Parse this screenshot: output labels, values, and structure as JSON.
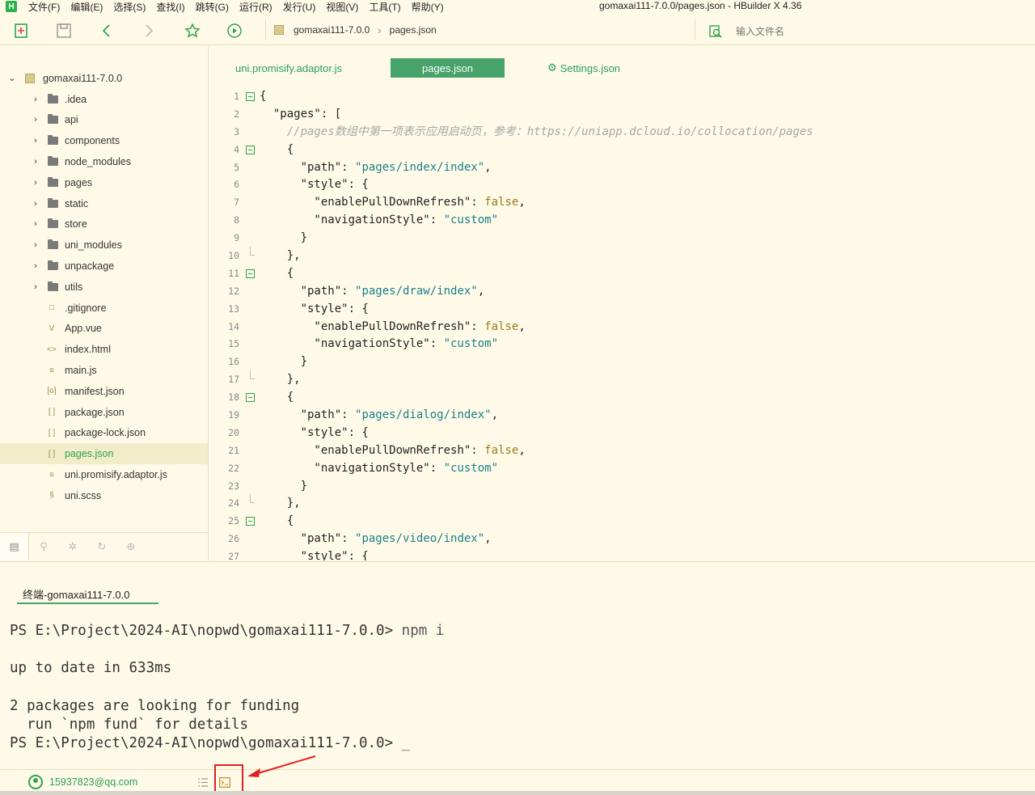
{
  "app": {
    "logo_letter": "H",
    "window_title": "gomaxai111-7.0.0/pages.json - HBuilder X 4.36",
    "menu": [
      "文件(F)",
      "编辑(E)",
      "选择(S)",
      "查找(I)",
      "跳转(G)",
      "运行(R)",
      "发行(U)",
      "视图(V)",
      "工具(T)",
      "帮助(Y)"
    ]
  },
  "toolbar": {
    "breadcrumb": [
      "gomaxai111-7.0.0",
      "pages.json"
    ],
    "file_search_placeholder": "输入文件名"
  },
  "sidebar": {
    "project": "gomaxai111-7.0.0",
    "folders": [
      ".idea",
      "api",
      "components",
      "node_modules",
      "pages",
      "static",
      "store",
      "uni_modules",
      "unpackage",
      "utils"
    ],
    "files": [
      {
        "name": ".gitignore",
        "icon": "□"
      },
      {
        "name": "App.vue",
        "icon": "V"
      },
      {
        "name": "index.html",
        "icon": "<>"
      },
      {
        "name": "main.js",
        "icon": "≡"
      },
      {
        "name": "manifest.json",
        "icon": "[o]"
      },
      {
        "name": "package.json",
        "icon": "[ ]"
      },
      {
        "name": "package-lock.json",
        "icon": "[ ]"
      },
      {
        "name": "pages.json",
        "icon": "[ ]"
      },
      {
        "name": "uni.promisify.adaptor.js",
        "icon": "≡"
      },
      {
        "name": "uni.scss",
        "icon": "§"
      }
    ],
    "selected": "pages.json"
  },
  "editor": {
    "tabs": [
      "uni.promisify.adaptor.js",
      "pages.json",
      "Settings.json"
    ],
    "active_tab": "pages.json",
    "lines": [
      {
        "n": "1",
        "fold": "open",
        "t": [
          [
            "k",
            "{"
          ]
        ]
      },
      {
        "n": "2",
        "t": [
          [
            "k",
            "  "
          ],
          [
            "k",
            "\"pages\""
          ],
          [
            "k",
            ": ["
          ]
        ]
      },
      {
        "n": "3",
        "t": [
          [
            "k",
            "    "
          ],
          [
            "c",
            "//pages数组中第一项表示应用启动页，参考：https://uniapp.dcloud.io/collocation/pages"
          ]
        ]
      },
      {
        "n": "4",
        "fold": "open",
        "t": [
          [
            "k",
            "    {"
          ]
        ]
      },
      {
        "n": "5",
        "t": [
          [
            "k",
            "      \"path\": "
          ],
          [
            "s",
            "\"pages/index/index\""
          ],
          [
            "k",
            ","
          ]
        ]
      },
      {
        "n": "6",
        "t": [
          [
            "k",
            "      \"style\": {"
          ]
        ]
      },
      {
        "n": "7",
        "t": [
          [
            "k",
            "        \"enablePullDownRefresh\": "
          ],
          [
            "b",
            "false"
          ],
          [
            "k",
            ","
          ]
        ]
      },
      {
        "n": "8",
        "t": [
          [
            "k",
            "        \"navigationStyle\": "
          ],
          [
            "s",
            "\"custom\""
          ]
        ]
      },
      {
        "n": "9",
        "t": [
          [
            "k",
            "      }"
          ]
        ]
      },
      {
        "n": "10",
        "fold": "end",
        "t": [
          [
            "k",
            "    },"
          ]
        ]
      },
      {
        "n": "11",
        "fold": "open",
        "t": [
          [
            "k",
            "    {"
          ]
        ]
      },
      {
        "n": "12",
        "t": [
          [
            "k",
            "      \"path\": "
          ],
          [
            "s",
            "\"pages/draw/index\""
          ],
          [
            "k",
            ","
          ]
        ]
      },
      {
        "n": "13",
        "t": [
          [
            "k",
            "      \"style\": {"
          ]
        ]
      },
      {
        "n": "14",
        "t": [
          [
            "k",
            "        \"enablePullDownRefresh\": "
          ],
          [
            "b",
            "false"
          ],
          [
            "k",
            ","
          ]
        ]
      },
      {
        "n": "15",
        "t": [
          [
            "k",
            "        \"navigationStyle\": "
          ],
          [
            "s",
            "\"custom\""
          ]
        ]
      },
      {
        "n": "16",
        "t": [
          [
            "k",
            "      }"
          ]
        ]
      },
      {
        "n": "17",
        "fold": "end",
        "t": [
          [
            "k",
            "    },"
          ]
        ]
      },
      {
        "n": "18",
        "fold": "open",
        "t": [
          [
            "k",
            "    {"
          ]
        ]
      },
      {
        "n": "19",
        "t": [
          [
            "k",
            "      \"path\": "
          ],
          [
            "s",
            "\"pages/dialog/index\""
          ],
          [
            "k",
            ","
          ]
        ]
      },
      {
        "n": "20",
        "t": [
          [
            "k",
            "      \"style\": {"
          ]
        ]
      },
      {
        "n": "21",
        "t": [
          [
            "k",
            "        \"enablePullDownRefresh\": "
          ],
          [
            "b",
            "false"
          ],
          [
            "k",
            ","
          ]
        ]
      },
      {
        "n": "22",
        "t": [
          [
            "k",
            "        \"navigationStyle\": "
          ],
          [
            "s",
            "\"custom\""
          ]
        ]
      },
      {
        "n": "23",
        "t": [
          [
            "k",
            "      }"
          ]
        ]
      },
      {
        "n": "24",
        "fold": "end",
        "t": [
          [
            "k",
            "    },"
          ]
        ]
      },
      {
        "n": "25",
        "fold": "open",
        "t": [
          [
            "k",
            "    {"
          ]
        ]
      },
      {
        "n": "26",
        "t": [
          [
            "k",
            "      \"path\": "
          ],
          [
            "s",
            "\"pages/video/index\""
          ],
          [
            "k",
            ","
          ]
        ]
      },
      {
        "n": "27",
        "t": [
          [
            "k",
            "      \"style\": {"
          ]
        ]
      }
    ]
  },
  "terminal": {
    "tab": "终端-gomaxai111-7.0.0",
    "lines": [
      {
        "prompt": "PS E:\\Project\\2024-AI\\nopwd\\gomaxai111-7.0.0> ",
        "cmd": "npm i"
      },
      {
        "text": ""
      },
      {
        "text": "up to date in 633ms"
      },
      {
        "text": ""
      },
      {
        "text": "2 packages are looking for funding"
      },
      {
        "text": "  run `npm fund` for details"
      },
      {
        "prompt": "PS E:\\Project\\2024-AI\\nopwd\\gomaxai111-7.0.0> ",
        "cmd": "_"
      }
    ]
  },
  "statusbar": {
    "user": "15937823@qq.com"
  },
  "colors": {
    "accent": "#47a36a",
    "background": "#fffae8",
    "annotation": "#e02020"
  }
}
